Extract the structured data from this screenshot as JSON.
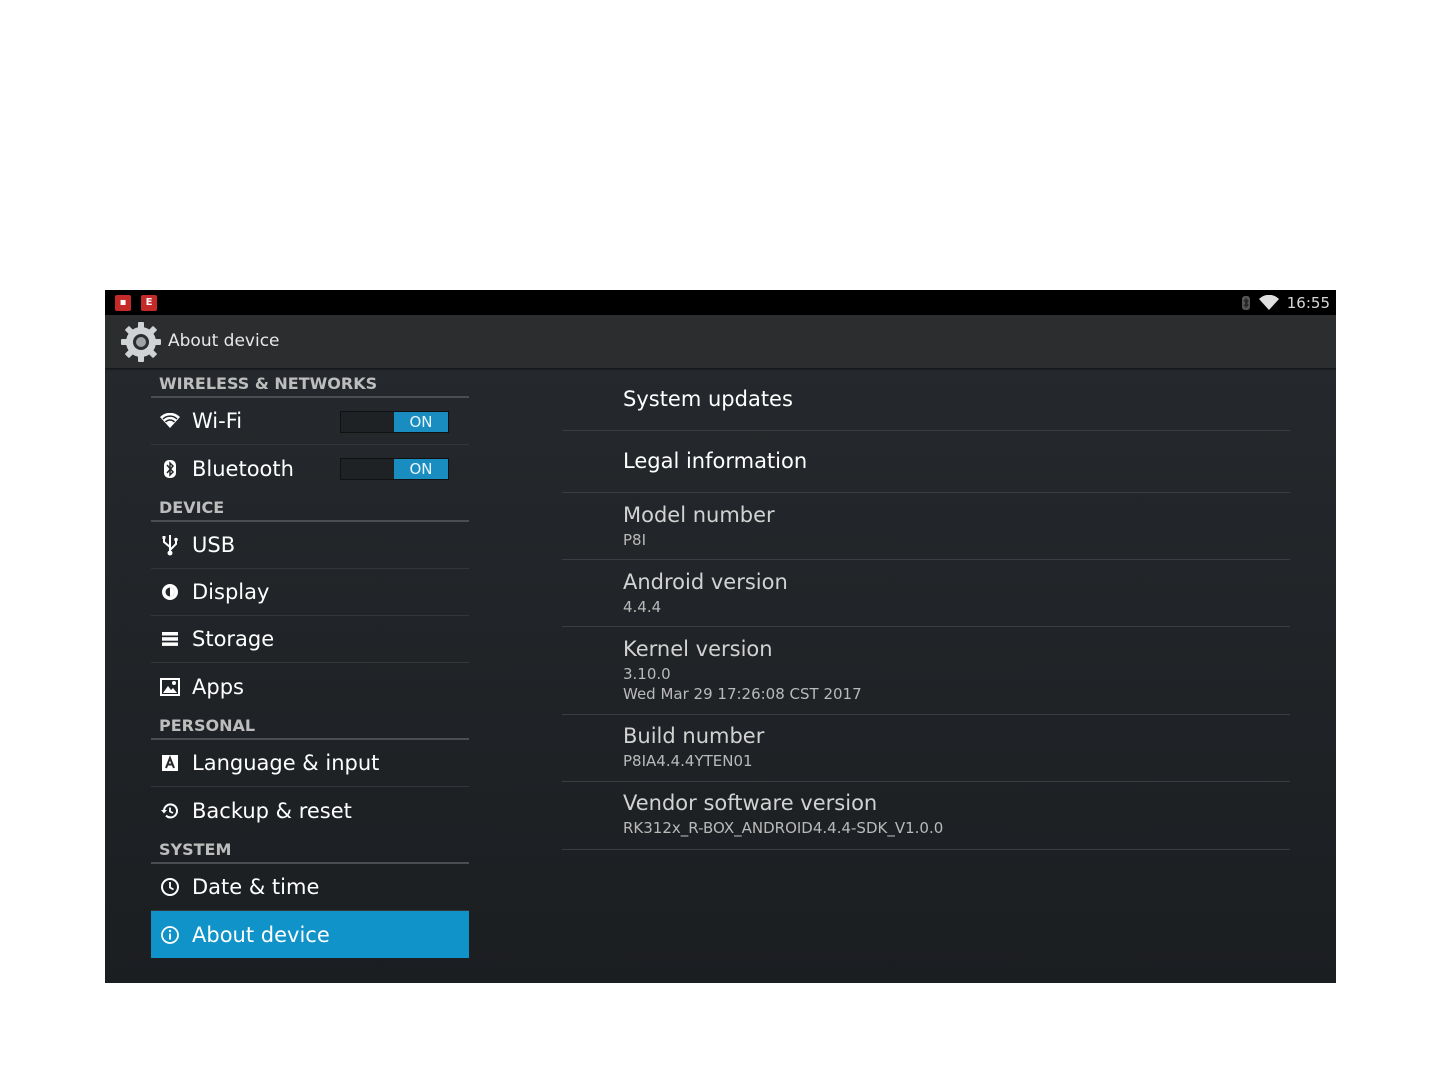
{
  "status_bar": {
    "time": "16:55",
    "notification_icons": [
      "app-red-icon",
      "app-e-icon"
    ]
  },
  "action_bar": {
    "title": "About device"
  },
  "sidebar": {
    "sections": [
      {
        "header": "WIRELESS & NETWORKS",
        "items": [
          {
            "label": "Wi-Fi",
            "icon": "wifi-icon",
            "toggle": "ON"
          },
          {
            "label": "Bluetooth",
            "icon": "bluetooth-icon",
            "toggle": "ON"
          }
        ]
      },
      {
        "header": "DEVICE",
        "items": [
          {
            "label": "USB",
            "icon": "usb-icon"
          },
          {
            "label": "Display",
            "icon": "display-icon"
          },
          {
            "label": "Storage",
            "icon": "storage-icon"
          },
          {
            "label": "Apps",
            "icon": "apps-icon"
          }
        ]
      },
      {
        "header": "PERSONAL",
        "items": [
          {
            "label": "Language & input",
            "icon": "language-icon"
          },
          {
            "label": "Backup & reset",
            "icon": "backup-icon"
          }
        ]
      },
      {
        "header": "SYSTEM",
        "items": [
          {
            "label": "Date & time",
            "icon": "clock-icon"
          },
          {
            "label": "About device",
            "icon": "info-icon",
            "selected": true
          }
        ]
      }
    ]
  },
  "details": [
    {
      "title": "System updates"
    },
    {
      "title": "Legal information"
    },
    {
      "title": "Model number",
      "summary": "P8I"
    },
    {
      "title": "Android version",
      "summary": "4.4.4"
    },
    {
      "title": "Kernel version",
      "summary": "3.10.0",
      "summary2": "Wed Mar 29 17:26:08 CST 2017"
    },
    {
      "title": "Build number",
      "summary": "P8IA4.4.4YTEN01"
    },
    {
      "title": "Vendor software version",
      "summary": "RK312x_R-BOX_ANDROID4.4.4-SDK_V1.0.0"
    }
  ],
  "colors": {
    "accent": "#0f93c8",
    "toggle_on": "#1a8dc0",
    "background": "#1e2124"
  }
}
